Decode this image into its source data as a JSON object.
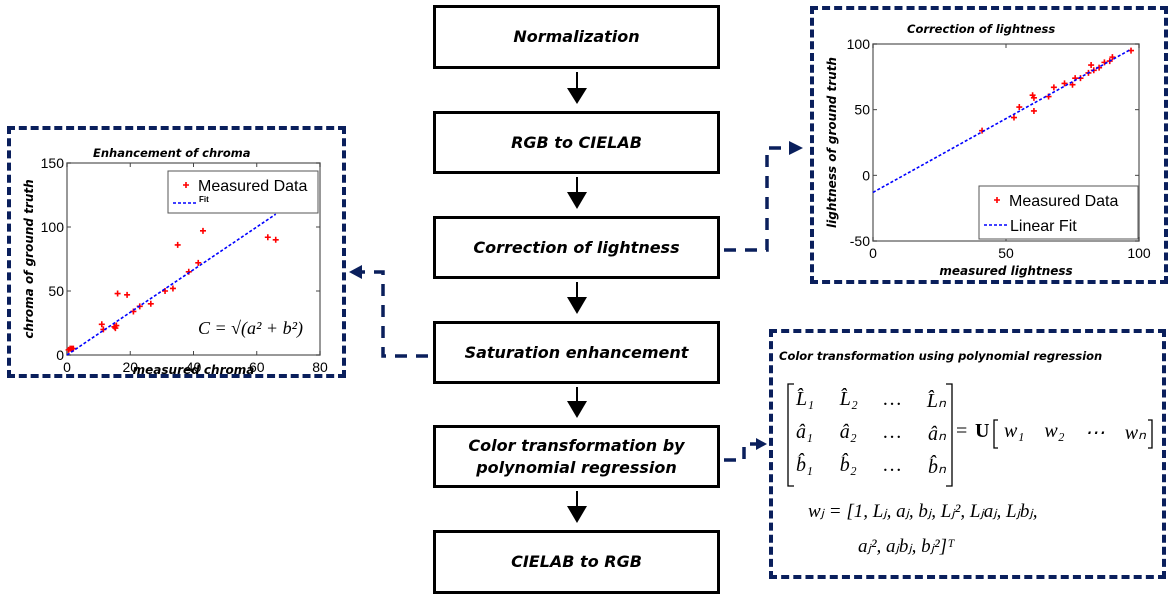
{
  "flow": {
    "steps": [
      {
        "label": "Normalization"
      },
      {
        "label": "RGB to CIELAB"
      },
      {
        "label": "Correction of lightness"
      },
      {
        "label": "Saturation enhancement"
      },
      {
        "label": "Color transformation by polynomial regression"
      },
      {
        "label": "CIELAB to RGB"
      }
    ],
    "arrow_color": "#000000",
    "connector_color": "#0a1f5c"
  },
  "chroma_panel": {
    "title": "Enhancement of chroma",
    "formula": "C = √(a² + b²)"
  },
  "lightness_panel": {
    "title": "Correction of lightness"
  },
  "poly_panel": {
    "title": "Color transformation using polynomial regression",
    "matrix_rows": [
      [
        "L̂₁",
        "L̂₂",
        "…",
        "L̂ₙ"
      ],
      [
        "â₁",
        "â₂",
        "…",
        "âₙ"
      ],
      [
        "b̂₁",
        "b̂₂",
        "…",
        "b̂ₙ"
      ]
    ],
    "rhs_U": "U",
    "rhs_w": [
      "w₁",
      "w₂",
      "⋯",
      "wₙ"
    ],
    "equals": "=",
    "wj_line1": "wⱼ = [1, Lⱼ, aⱼ, bⱼ, Lⱼ², Lⱼaⱼ, Lⱼbⱼ,",
    "wj_line2": "aⱼ², aⱼbⱼ, bⱼ²]ᵀ"
  },
  "chart_data": [
    {
      "type": "scatter",
      "title": "Enhancement of chroma",
      "xlabel": "measured chroma",
      "ylabel": "chroma of ground truth",
      "xlim": [
        0,
        80
      ],
      "ylim": [
        0,
        150
      ],
      "xticks": [
        0,
        20,
        40,
        60,
        80
      ],
      "yticks": [
        0,
        50,
        100,
        150
      ],
      "legend": {
        "placement": "top-right",
        "entries": [
          "Measured Data",
          "Fit"
        ]
      },
      "series": [
        {
          "name": "Measured Data",
          "marker": "+",
          "color": "#ff0000",
          "points": [
            [
              0.5,
              4
            ],
            [
              1,
              5
            ],
            [
              1.5,
              5
            ],
            [
              2,
              5
            ],
            [
              11,
              24
            ],
            [
              11.5,
              20
            ],
            [
              15,
              22
            ],
            [
              15.3,
              21
            ],
            [
              15.6,
              23
            ],
            [
              16,
              48
            ],
            [
              19,
              47
            ],
            [
              21,
              34
            ],
            [
              23,
              38
            ],
            [
              26.5,
              40
            ],
            [
              31,
              50
            ],
            [
              33.5,
              52
            ],
            [
              35,
              86
            ],
            [
              38.5,
              65
            ],
            [
              41.5,
              72
            ],
            [
              43,
              97
            ],
            [
              63.5,
              92
            ],
            [
              66,
              90
            ]
          ]
        },
        {
          "name": "Fit",
          "style": "dashed-line",
          "color": "#0000ff",
          "points": [
            [
              0,
              0
            ],
            [
              66,
              110
            ]
          ]
        }
      ]
    },
    {
      "type": "scatter",
      "title": "Correction of lightness",
      "xlabel": "measured lightness",
      "ylabel": "lightness of ground truth",
      "xlim": [
        0,
        100
      ],
      "ylim": [
        -50,
        100
      ],
      "xticks": [
        0,
        50,
        100
      ],
      "yticks": [
        -50,
        0,
        50,
        100
      ],
      "legend": {
        "placement": "bottom-right",
        "entries": [
          "Measured Data",
          "Linear Fit"
        ]
      },
      "series": [
        {
          "name": "Measured Data",
          "marker": "+",
          "color": "#ff0000",
          "points": [
            [
              41,
              34
            ],
            [
              53,
              44
            ],
            [
              55,
              52
            ],
            [
              60,
              61
            ],
            [
              60.5,
              59
            ],
            [
              60.5,
              49
            ],
            [
              66,
              60
            ],
            [
              68,
              67
            ],
            [
              72,
              70
            ],
            [
              75,
              69
            ],
            [
              76,
              74
            ],
            [
              78,
              74
            ],
            [
              81,
              78
            ],
            [
              82,
              84
            ],
            [
              83,
              80
            ],
            [
              85,
              82
            ],
            [
              87,
              86
            ],
            [
              89,
              87
            ],
            [
              90,
              90
            ],
            [
              97,
              95
            ]
          ]
        },
        {
          "name": "Linear Fit",
          "style": "dashed-line",
          "color": "#0000ff",
          "points": [
            [
              0,
              -13
            ],
            [
              97,
              96
            ]
          ]
        }
      ]
    }
  ]
}
